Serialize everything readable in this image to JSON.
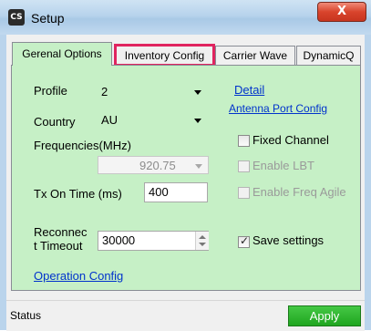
{
  "window": {
    "app_icon_text": "CS",
    "title": "Setup",
    "close_glyph": "X"
  },
  "tabs": [
    {
      "label": "Gerenal Options",
      "active": true
    },
    {
      "label": "Inventory Config",
      "highlighted": true
    },
    {
      "label": "Carrier Wave"
    },
    {
      "label": "DynamicQ"
    }
  ],
  "general": {
    "profile_label": "Profile",
    "profile_value": "2",
    "country_label": "Country",
    "country_value": "AU",
    "frequencies_label": "Frequencies(MHz)",
    "frequency_value": "920.75",
    "tx_on_time_label": "Tx On Time (ms)",
    "tx_on_time_value": "400",
    "reconnect_label_line1": "Reconnec",
    "reconnect_label_line2": "t Timeout",
    "reconnect_value": "30000",
    "operation_config_link": "Operation Config",
    "detail_link": "Detail",
    "antenna_port_config_link": "Antenna Port Config",
    "fixed_channel_label": "Fixed Channel",
    "fixed_channel_checked": false,
    "enable_lbt_label": "Enable LBT",
    "enable_lbt_checked": false,
    "enable_freq_agile_label": "Enable Freq Agile",
    "enable_freq_agile_checked": false,
    "save_settings_label": "Save settings",
    "save_settings_checked": true
  },
  "status": {
    "text": "Status",
    "apply_label": "Apply"
  },
  "colors": {
    "panel_bg": "#c6f0c6",
    "tab_highlight": "#e0245f",
    "link": "#0033cc",
    "apply_bg": "#2fb52f"
  }
}
